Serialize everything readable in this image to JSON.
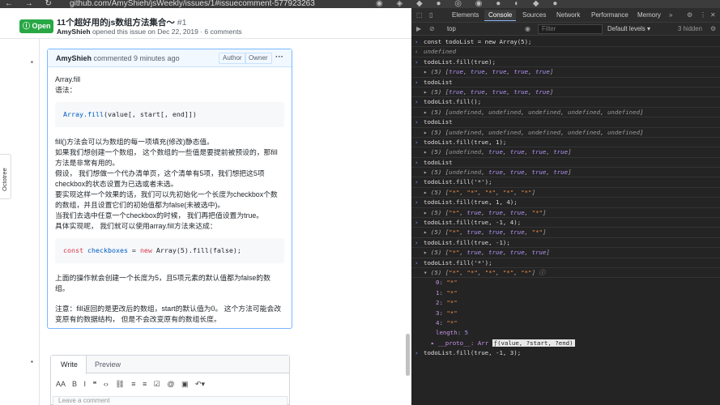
{
  "browser": {
    "nav_icons": "← → ↻",
    "url": "github.com/AmyShieh/jsWeekly/issues/1#issuecomment-577923263",
    "ext_icons": "◉ ◈ ◆ ● ◎ ◉ ● ◐ ◆ ●"
  },
  "issue": {
    "status": "Open",
    "title": "11个超好用的js数组方法集合～",
    "number": "#1",
    "author": "AmyShieh",
    "meta_rest": " opened this issue on Dec 22, 2019 · 6 comments"
  },
  "comment": {
    "author": "AmyShieh",
    "when": " commented 9 minutes ago",
    "badge_author": "Author",
    "badge_owner": "Owner",
    "menu": "···",
    "heading": "Array.fill",
    "syntax": "语法：",
    "code1_fn": "Array.fill",
    "code1_rest": "(value[, start[, end]])",
    "para1": [
      "fill()方法会可以为数组的每一项填充(修改)静态值。",
      "如果我们想创建一个数组， 这个数组的一些值是要提前被预设的，那fill",
      "方法是非常有用的。",
      "假设， 我们想做一个代办清单页，这个清单有5项，我们想把这5项",
      "checkbox的状态设置为已选或者未选。",
      "要实现这样一个效果的话，我们可以先初始化一个长度为checkbox个数",
      "的数组，并且设置它们的初始值都为false(未被选中)。",
      "当我们去选中任意一个checkbox的时候， 我们再把值设置为true。",
      "具体实现呢， 我们就可以使用array.fill方法来达成："
    ],
    "code2_kw": "const",
    "code2_var": "checkboxes",
    "code2_eq": " = ",
    "code2_new": "new",
    "code2_rest": " Array(5).fill(false);",
    "para2": [
      "上面的操作就会创建一个长度为5，且5项元素的默认值都为false的数",
      "组。"
    ],
    "para3": [
      "注意：fill返回的是更改后的数组，start的默认值为0。 这个方法可能会改",
      "变原有的数据结构， 但是不会改变原有的数组长度。"
    ]
  },
  "editor": {
    "tab_write": "Write",
    "tab_preview": "Preview",
    "toolbar": "AA B I  ❝ ‹› ⛓  ≡ ≡ ☑  @ ▣ ↶▾",
    "placeholder": "Leave a comment"
  },
  "octotree": "Octotree",
  "devtools": {
    "tabs": [
      "Elements",
      "Console",
      "Sources",
      "Network",
      "Performance",
      "Memory"
    ],
    "context": "top",
    "filter_placeholder": "Filter",
    "levels": "Default levels ▾",
    "hidden": "3 hidden",
    "lines": [
      {
        "kind": "in",
        "text": "const todoList = new Array(5);"
      },
      {
        "kind": "ret",
        "text": "undefined"
      },
      {
        "kind": "in",
        "text": "todoList.fill(true);"
      },
      {
        "kind": "out",
        "text": "▸ (5) [true, true, true, true, true]"
      },
      {
        "kind": "in",
        "text": "todoList"
      },
      {
        "kind": "out",
        "text": "▸ (5) [true, true, true, true, true]"
      },
      {
        "kind": "in",
        "text": "todoList.fill();"
      },
      {
        "kind": "out",
        "text": "▸ (5) [undefined, undefined, undefined, undefined, undefined]"
      },
      {
        "kind": "in",
        "text": "todoList"
      },
      {
        "kind": "out",
        "text": "▸ (5) [undefined, undefined, undefined, undefined, undefined]"
      },
      {
        "kind": "in",
        "text": "todoList.fill(true, 1);"
      },
      {
        "kind": "out",
        "text": "▸ (5) [undefined, true, true, true, true]"
      },
      {
        "kind": "in",
        "text": "todoList"
      },
      {
        "kind": "out",
        "text": "▸ (5) [undefined, true, true, true, true]"
      },
      {
        "kind": "in",
        "text": "todoList.fill('*');"
      },
      {
        "kind": "out",
        "text": "▸ (5) [\"*\", \"*\", \"*\", \"*\", \"*\"]"
      },
      {
        "kind": "in",
        "text": "todoList.fill(true, 1, 4);"
      },
      {
        "kind": "out",
        "text": "▸ (5) [\"*\", true, true, true, \"*\"]"
      },
      {
        "kind": "in",
        "text": "todoList.fill(true, -1, 4);"
      },
      {
        "kind": "out",
        "text": "▸ (5) [\"*\", true, true, true, \"*\"]"
      },
      {
        "kind": "in",
        "text": "todoList.fill(true, -1);"
      },
      {
        "kind": "out",
        "text": "▸ (5) [\"*\", true, true, true, true]"
      },
      {
        "kind": "in",
        "text": "todoList.fill('*');"
      },
      {
        "kind": "out",
        "text": "▾ (5) [\"*\", \"*\", \"*\", \"*\", \"*\"] ⓘ"
      }
    ],
    "expanded": [
      {
        "k": "0",
        "v": "\"*\""
      },
      {
        "k": "1",
        "v": "\"*\""
      },
      {
        "k": "2",
        "v": "\"*\""
      },
      {
        "k": "3",
        "v": "\"*\""
      },
      {
        "k": "4",
        "v": "\"*\""
      }
    ],
    "length_key": "length",
    "length_val": "5",
    "proto": "▸ __proto__: Arr",
    "tooltip": "ƒ(value, ?start, ?end)",
    "current_input": "todoList.fill(true, -1, 3);"
  }
}
